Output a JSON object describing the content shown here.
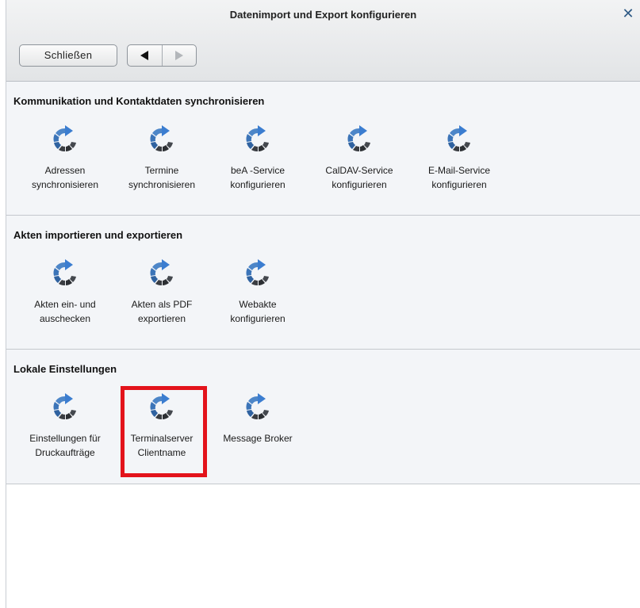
{
  "window": {
    "title": "Datenimport und Export konfigurieren"
  },
  "toolbar": {
    "close_label": "Schließen"
  },
  "sections": [
    {
      "title": "Kommunikation und Kontaktdaten synchronisieren",
      "items": [
        {
          "label": "Adressen\nsynchronisieren"
        },
        {
          "label": "Termine\nsynchronisieren"
        },
        {
          "label": "beA -Service\nkonfigurieren"
        },
        {
          "label": "CalDAV-Service\nkonfigurieren"
        },
        {
          "label": "E-Mail-Service\nkonfigurieren"
        }
      ]
    },
    {
      "title": "Akten importieren und exportieren",
      "items": [
        {
          "label": "Akten ein- und\nauschecken"
        },
        {
          "label": "Akten als PDF\nexportieren"
        },
        {
          "label": "Webakte\nkonfigurieren"
        }
      ]
    },
    {
      "title": "Lokale Einstellungen",
      "items": [
        {
          "label": "Einstellungen für\nDruckaufträge"
        },
        {
          "label": "Terminalserver\nClientname"
        },
        {
          "label": "Message Broker"
        }
      ]
    }
  ],
  "icons": {
    "action": "sync-arrow-icon"
  },
  "colors": {
    "highlight": "#e3131b",
    "icon_blue": "#2f6db3",
    "icon_dark": "#3a3d42"
  }
}
